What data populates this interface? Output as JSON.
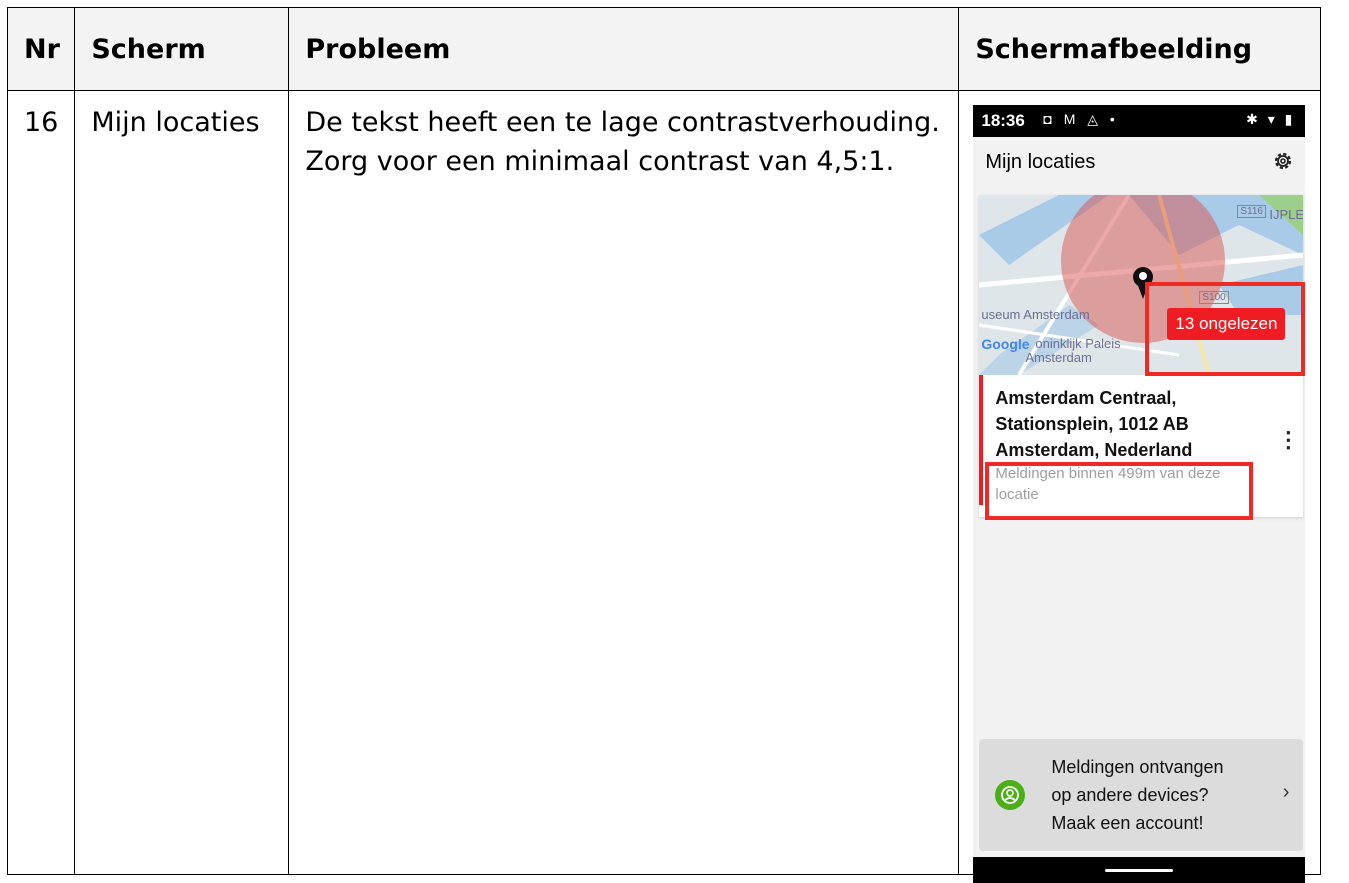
{
  "table": {
    "headers": [
      "Nr",
      "Scherm",
      "Probleem",
      "Schermafbeelding"
    ],
    "row": {
      "nr": "16",
      "scherm": "Mijn locaties",
      "probleem": "De tekst heeft een te lage contrastverhouding. Zorg voor een minimaal contrast van 4,5:1."
    }
  },
  "screenshot": {
    "status": {
      "time": "18:36",
      "left_icons": "◘ M ◬ •",
      "right_icons": "✱ ▾ ▮"
    },
    "app_title": "Mijn locaties",
    "map": {
      "badge": "13 ongelezen",
      "brand": "Google",
      "labels": [
        "useum Amsterdam",
        "oninklijk Paleis",
        "Amsterdam",
        "S116",
        "IJPLE",
        "S100"
      ]
    },
    "location": {
      "address": "Amsterdam Centraal, Stationsplein, 1012 AB Amsterdam, Nederland",
      "detail": "Meldingen binnen 499m van deze locatie"
    },
    "promo": {
      "line1": "Meldingen ontvangen",
      "line2": "op andere devices?",
      "line3": "Maak een account!"
    },
    "colors": {
      "accent_red": "#ef1c24",
      "promo_green": "#4caf1a",
      "low_contrast_text": "#9e9e9e"
    }
  }
}
